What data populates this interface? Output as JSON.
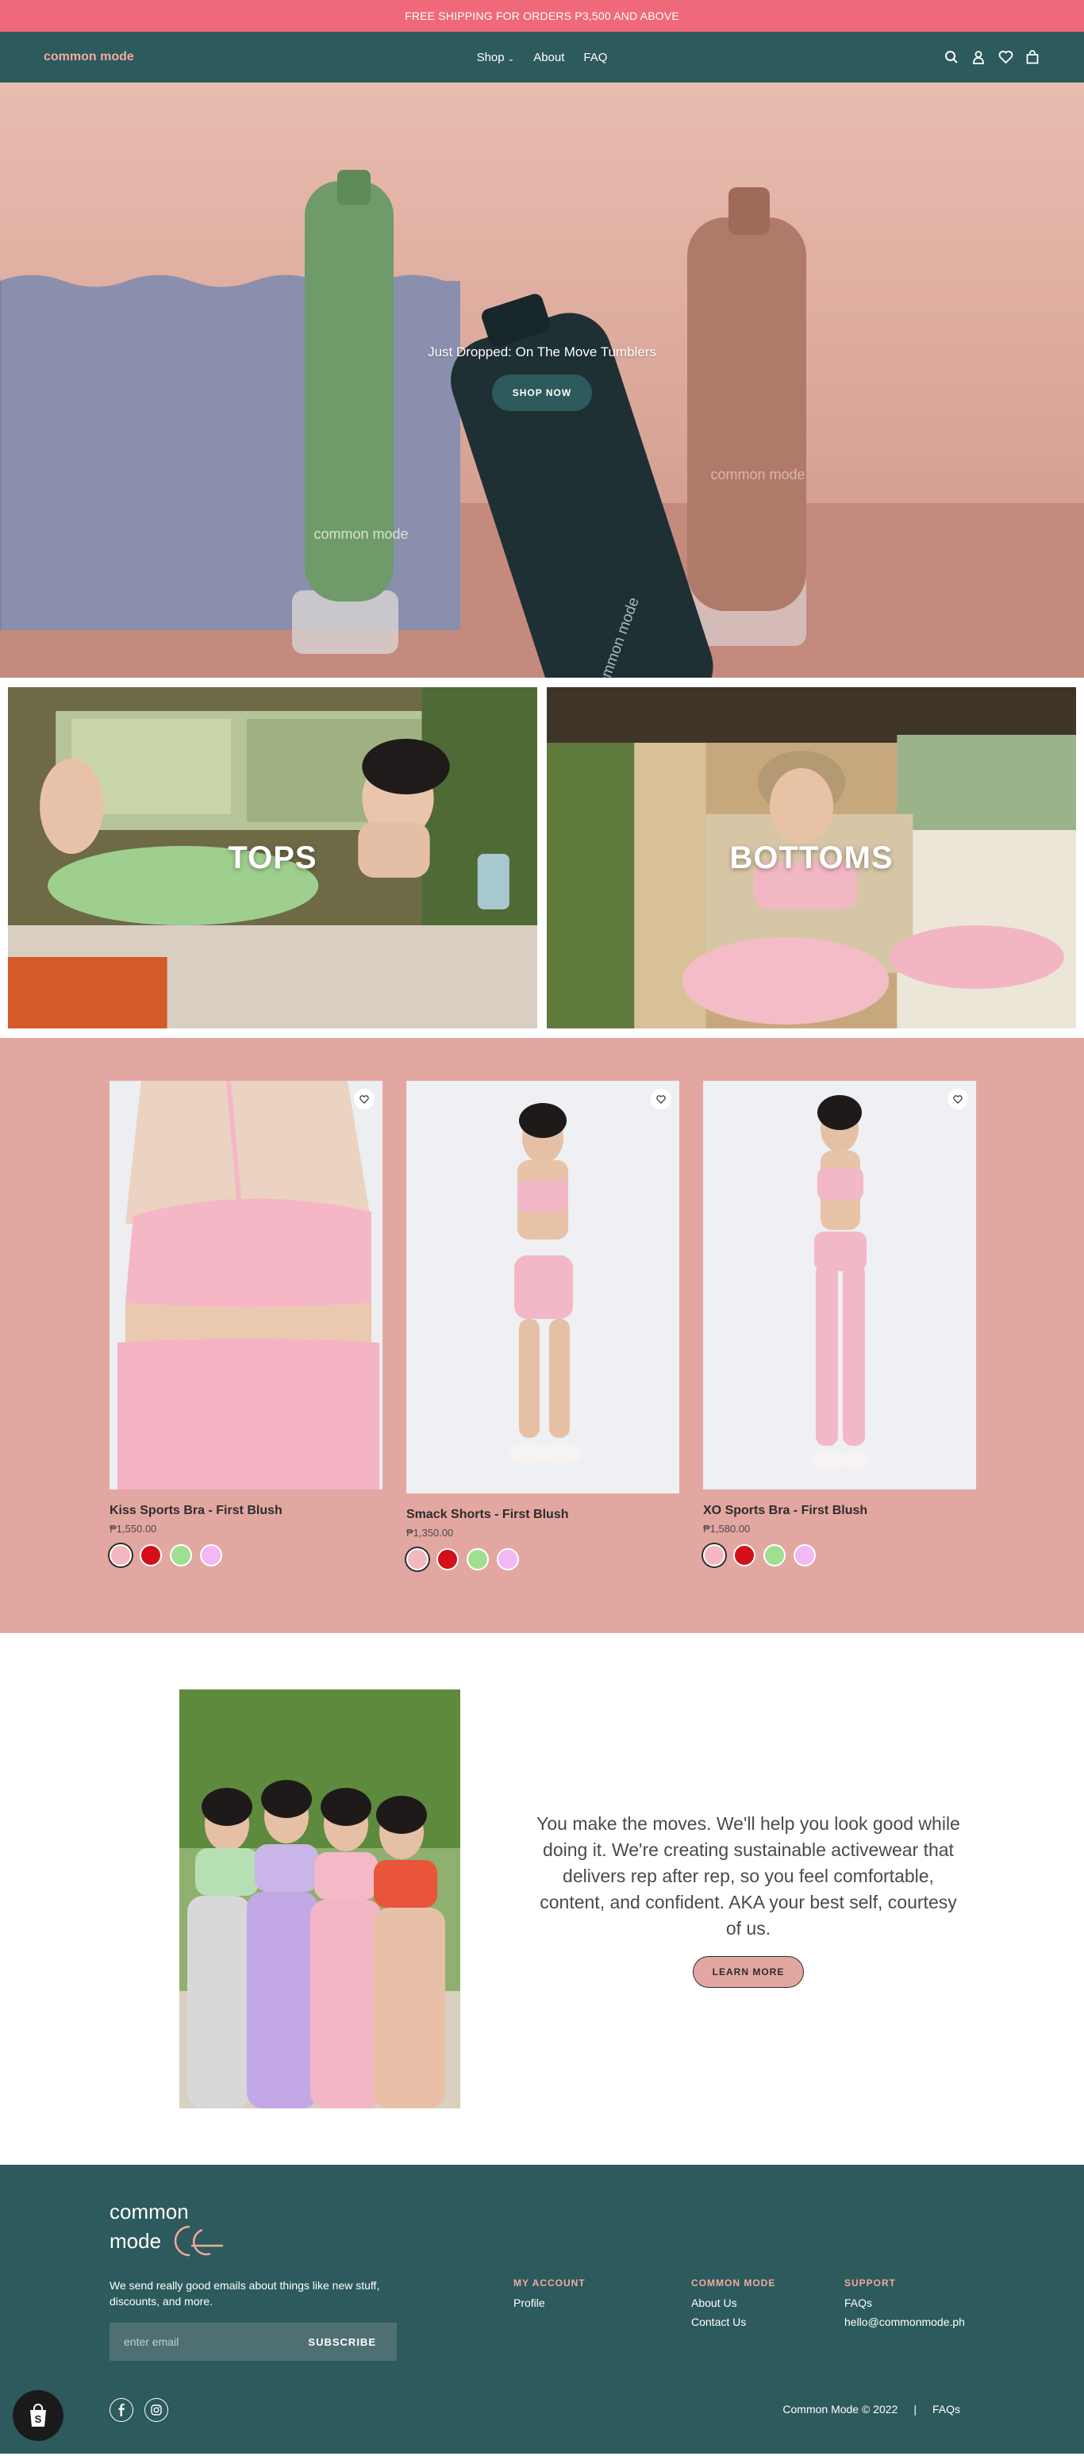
{
  "announcement": "FREE SHIPPING FOR ORDERS P3,500 AND ABOVE",
  "header": {
    "logo": "common mode",
    "nav": [
      {
        "label": "Shop",
        "has_dropdown": true
      },
      {
        "label": "About"
      },
      {
        "label": "FAQ"
      }
    ],
    "icons": [
      "search-icon",
      "account-icon",
      "heart-icon",
      "bag-icon"
    ]
  },
  "hero": {
    "title": "Just Dropped: On The Move Tumblers",
    "button": "SHOP NOW",
    "bottle_text": "common mode"
  },
  "collections": [
    {
      "label": "TOPS"
    },
    {
      "label": "BOTTOMS"
    }
  ],
  "products": [
    {
      "name": "Kiss Sports Bra - First Blush",
      "price": "₱1,550.00"
    },
    {
      "name": "Smack Shorts - First Blush",
      "price": "₱1,350.00"
    },
    {
      "name": "XO Sports Bra - First Blush",
      "price": "₱1,580.00"
    }
  ],
  "swatch_colors": [
    "#f5b8c0",
    "#d3101a",
    "#9ee08f",
    "#f3b7f3"
  ],
  "about": {
    "copy": "You make the moves. We'll help you look good while doing it. We're creating sustainable activewear that delivers rep after rep, so you feel comfortable, content, and confident. AKA your best self, courtesy of us.",
    "button": "LEARN MORE"
  },
  "footer": {
    "logo_line1": "common",
    "logo_line2": "mode",
    "tagline": "We send really good emails about things like new stuff, discounts, and more.",
    "email_placeholder": "enter email",
    "subscribe": "SUBSCRIBE",
    "columns": [
      {
        "title": "MY ACCOUNT",
        "links": [
          "Profile"
        ]
      },
      {
        "title": "COMMON MODE",
        "links": [
          "About Us",
          "Contact Us"
        ]
      },
      {
        "title": "SUPPORT",
        "links": [
          "FAQs",
          "hello@commonmode.ph"
        ]
      }
    ],
    "copyright": "Common Mode © 2022",
    "faqs": "FAQs"
  },
  "colors": {
    "announcement": "#f0697a",
    "header": "#2d5a5c",
    "accent_pink": "#e3a7a1",
    "logo_pink": "#f2a9a0"
  }
}
